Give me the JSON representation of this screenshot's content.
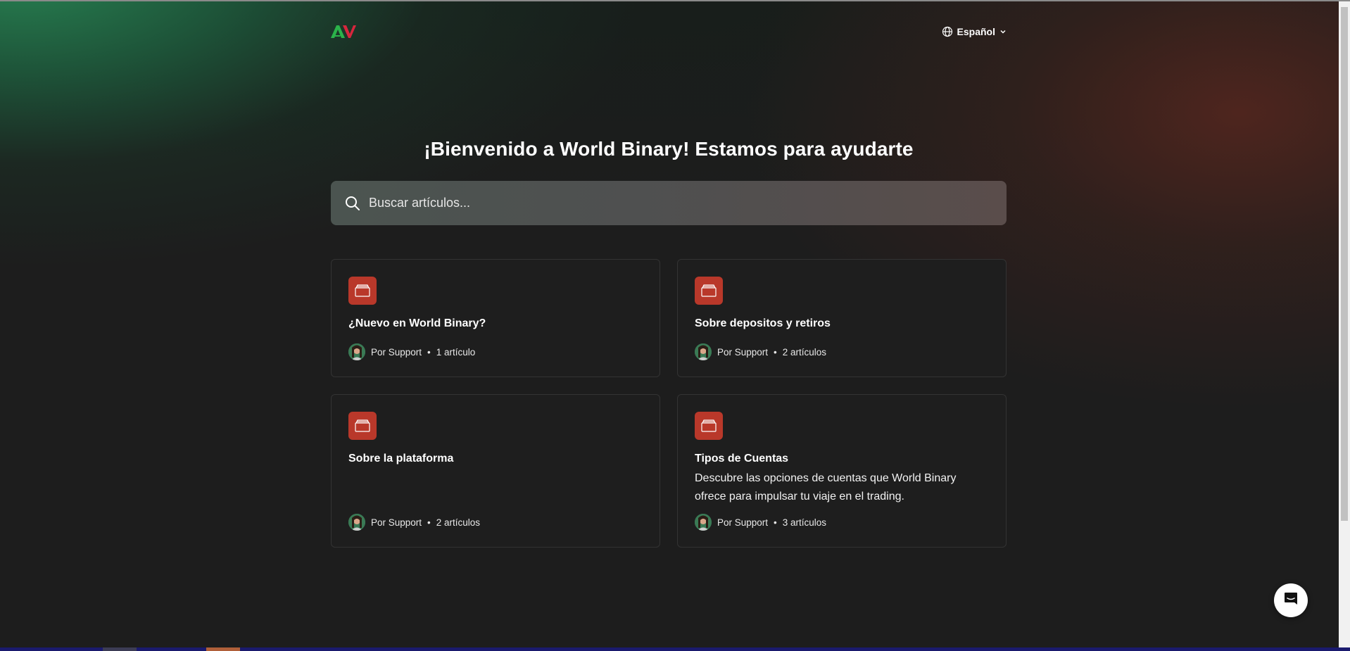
{
  "header": {
    "logo_icon": "av-logo-icon",
    "language_label": "Español"
  },
  "hero": {
    "title": "¡Bienvenido a World Binary! Estamos para ayudarte"
  },
  "search": {
    "placeholder": "Buscar artículos..."
  },
  "collections": [
    {
      "title": "¿Nuevo en World Binary?",
      "description": "",
      "author": "Por Support",
      "separator": "•",
      "count": "1 artículo"
    },
    {
      "title": "Sobre depositos y retiros",
      "description": "",
      "author": "Por Support",
      "separator": "•",
      "count": "2 artículos"
    },
    {
      "title": "Sobre la plataforma",
      "description": "",
      "author": "Por Support",
      "separator": "•",
      "count": "2 artículos"
    },
    {
      "title": "Tipos de Cuentas",
      "description": "Descubre las opciones de cuentas que World Binary ofrece para impulsar tu viaje en el trading.",
      "author": "Por Support",
      "separator": "•",
      "count": "3 artículos"
    }
  ],
  "colors": {
    "accent_icon_bg": "#b9382a",
    "card_bg": "#1e1e1e",
    "page_bg": "#1d1d1d",
    "logo_green": "#2bb34a",
    "logo_red": "#d7263d"
  },
  "chat": {
    "icon": "chat-launcher-icon"
  }
}
